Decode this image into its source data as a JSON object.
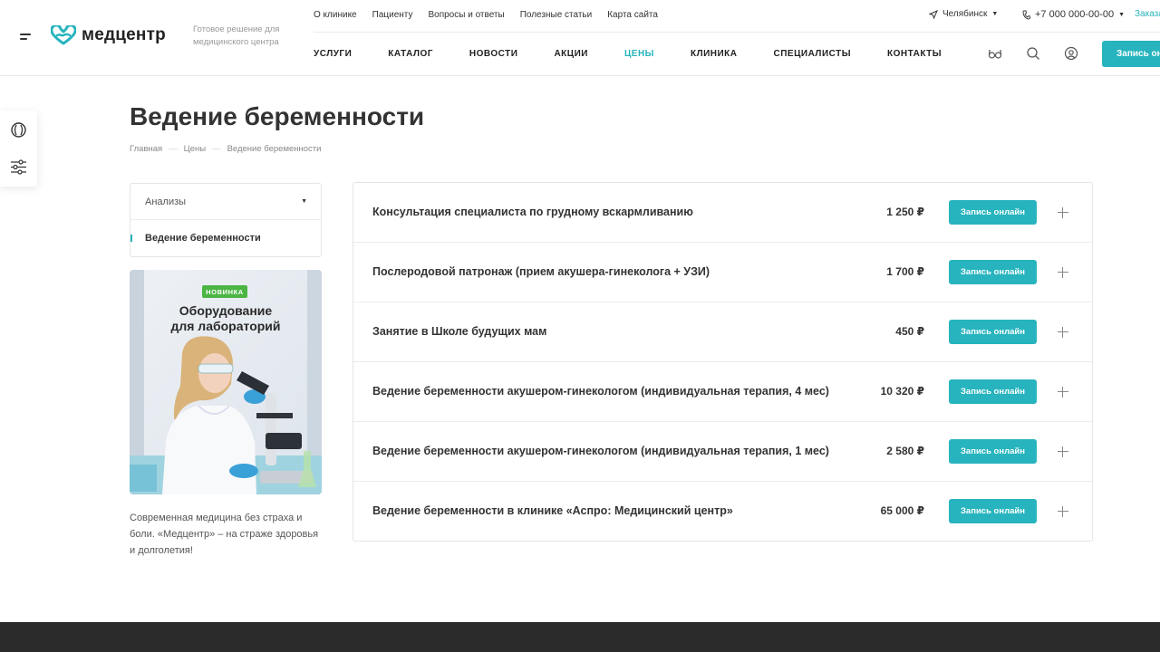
{
  "header": {
    "logo_text": "медцентр",
    "slogan": "Готовое решение для медицинского центра",
    "top_links": [
      "О клинике",
      "Пациенту",
      "Вопросы и ответы",
      "Полезные статьи",
      "Карта сайта"
    ],
    "city": "Челябинск",
    "phone": "+7 000 000-00-00",
    "order_call": "Заказать звонок",
    "main_nav": [
      "УСЛУГИ",
      "КАТАЛОГ",
      "НОВОСТИ",
      "АКЦИИ",
      "ЦЕНЫ",
      "КЛИНИКА",
      "СПЕЦИАЛИСТЫ",
      "КОНТАКТЫ"
    ],
    "active_nav": "ЦЕНЫ",
    "record_button": "Запись онлайн",
    "accent_color": "#27b4be"
  },
  "page": {
    "title": "Ведение беременности",
    "breadcrumbs": [
      "Главная",
      "Цены",
      "Ведение беременности"
    ]
  },
  "sidebar": {
    "menu": [
      {
        "label": "Анализы",
        "expandable": true
      },
      {
        "label": "Ведение беременности",
        "active": true
      }
    ],
    "promo": {
      "badge": "НОВИНКА",
      "title_line1": "Оборудование",
      "title_line2": "для лабораторий"
    },
    "note": "Современная медицина без страха и боли. «Медцентр» – на страже здоровья и долголетия!"
  },
  "prices": {
    "button_label": "Запись онлайн",
    "items": [
      {
        "name": "Консультация специалиста по грудному вскармливанию",
        "price": "1 250 ₽"
      },
      {
        "name": "Послеродовой патронаж (прием акушера-гинеколога + УЗИ)",
        "price": "1 700 ₽"
      },
      {
        "name": "Занятие в Школе будущих мам",
        "price": "450 ₽"
      },
      {
        "name": "Ведение беременности акушером-гинекологом (индивидуальная терапия, 4 мес)",
        "price": "10 320 ₽"
      },
      {
        "name": "Ведение беременности акушером-гинекологом (индивидуальная терапия, 1 мес)",
        "price": "2 580 ₽"
      },
      {
        "name": "Ведение беременности в клинике «Аспро: Медицинский центр»",
        "price": "65 000 ₽"
      }
    ]
  }
}
